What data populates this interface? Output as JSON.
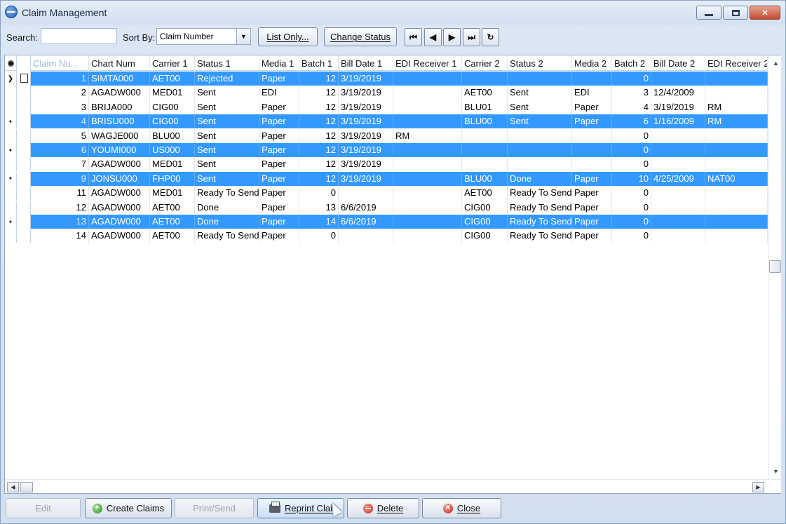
{
  "window": {
    "title": "Claim Management"
  },
  "toolbar": {
    "search_label": "Search:",
    "search_value": "",
    "sort_label": "Sort By:",
    "sort_value": "Claim Number",
    "list_only": "List Only...",
    "change_status": "Change Status",
    "nav": [
      "⏮",
      "◀",
      "▶",
      "⏭",
      "↻"
    ]
  },
  "columns": [
    "Claim Nu...",
    "Chart Num",
    "Carrier 1",
    "Status 1",
    "Media 1",
    "Batch 1",
    "Bill Date 1",
    "EDI Receiver 1",
    "Carrier 2",
    "Status 2",
    "Media 2",
    "Batch 2",
    "Bill Date 2",
    "EDI Receiver 2"
  ],
  "rows": [
    {
      "selected": true,
      "marker": "current",
      "cells": [
        "1",
        "SIMTA000",
        "AET00",
        "Rejected",
        "Paper",
        "12",
        "3/19/2019",
        "",
        "",
        "",
        "",
        "0",
        "",
        ""
      ]
    },
    {
      "selected": false,
      "marker": "",
      "cells": [
        "2",
        "AGADW000",
        "MED01",
        "Sent",
        "EDI",
        "12",
        "3/19/2019",
        "",
        "AET00",
        "Sent",
        "EDI",
        "3",
        "12/4/2009",
        ""
      ]
    },
    {
      "selected": false,
      "marker": "",
      "cells": [
        "3",
        "BRIJA000",
        "CIG00",
        "Sent",
        "Paper",
        "12",
        "3/19/2019",
        "",
        "BLU01",
        "Sent",
        "Paper",
        "4",
        "3/19/2019",
        "RM"
      ]
    },
    {
      "selected": true,
      "marker": "dot",
      "cells": [
        "4",
        "BRISU000",
        "CIG00",
        "Sent",
        "Paper",
        "12",
        "3/19/2019",
        "",
        "BLU00",
        "Sent",
        "Paper",
        "6",
        "1/16/2009",
        "RM"
      ]
    },
    {
      "selected": false,
      "marker": "",
      "cells": [
        "5",
        "WAGJE000",
        "BLU00",
        "Sent",
        "Paper",
        "12",
        "3/19/2019",
        "RM",
        "",
        "",
        "",
        "0",
        "",
        ""
      ]
    },
    {
      "selected": true,
      "marker": "dot",
      "cells": [
        "6",
        "YOUMI000",
        "US000",
        "Sent",
        "Paper",
        "12",
        "3/19/2019",
        "",
        "",
        "",
        "",
        "0",
        "",
        ""
      ]
    },
    {
      "selected": false,
      "marker": "",
      "cells": [
        "7",
        "AGADW000",
        "MED01",
        "Sent",
        "Paper",
        "12",
        "3/19/2019",
        "",
        "",
        "",
        "",
        "0",
        "",
        ""
      ]
    },
    {
      "selected": true,
      "marker": "dot",
      "cells": [
        "9",
        "JONSU000",
        "FHP00",
        "Sent",
        "Paper",
        "12",
        "3/19/2019",
        "",
        "BLU00",
        "Done",
        "Paper",
        "10",
        "4/25/2009",
        "NAT00"
      ]
    },
    {
      "selected": false,
      "marker": "",
      "cells": [
        "11",
        "AGADW000",
        "MED01",
        "Ready To Send",
        "Paper",
        "0",
        "",
        "",
        "AET00",
        "Ready To Send",
        "Paper",
        "0",
        "",
        ""
      ]
    },
    {
      "selected": false,
      "marker": "",
      "cells": [
        "12",
        "AGADW000",
        "AET00",
        "Done",
        "Paper",
        "13",
        "6/6/2019",
        "",
        "CIG00",
        "Ready To Send",
        "Paper",
        "0",
        "",
        ""
      ]
    },
    {
      "selected": true,
      "marker": "dot",
      "cells": [
        "13",
        "AGADW000",
        "AET00",
        "Done",
        "Paper",
        "14",
        "6/6/2019",
        "",
        "CIG00",
        "Ready To Send",
        "Paper",
        "0",
        "",
        ""
      ]
    },
    {
      "selected": false,
      "marker": "",
      "cells": [
        "14",
        "AGADW000",
        "AET00",
        "Ready To Send",
        "Paper",
        "0",
        "",
        "",
        "CIG00",
        "Ready To Send",
        "Paper",
        "0",
        "",
        ""
      ]
    }
  ],
  "bottom": {
    "edit": "Edit",
    "create": "Create Claims",
    "print": "Print/Send",
    "reprint": "Reprint Clai",
    "delete": "Delete",
    "close": "Close"
  },
  "colors": {
    "selection": "#3399ff",
    "window_bg": "#d8e4f2"
  }
}
